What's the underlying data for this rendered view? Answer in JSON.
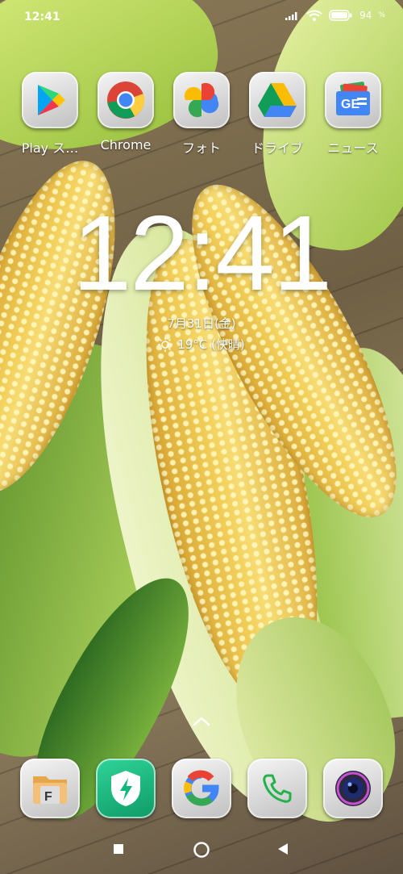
{
  "status_bar": {
    "time": "12:41",
    "battery_percent": "94",
    "icons": [
      "signal-icon",
      "wifi-icon",
      "battery-icon"
    ]
  },
  "apps": [
    {
      "label": "Play ス…",
      "icon": "play-store-icon"
    },
    {
      "label": "Chrome",
      "icon": "chrome-icon"
    },
    {
      "label": "フォト",
      "icon": "google-photos-icon"
    },
    {
      "label": "ドライブ",
      "icon": "google-drive-icon"
    },
    {
      "label": "ニュース",
      "icon": "google-news-icon"
    }
  ],
  "clock": {
    "time": "12:41",
    "date": "7月31日(金)",
    "weather": "19°C (快晴)",
    "weather_icon": "sun-icon"
  },
  "dock": [
    {
      "icon": "file-manager-icon"
    },
    {
      "icon": "security-icon"
    },
    {
      "icon": "google-icon"
    },
    {
      "icon": "phone-icon"
    },
    {
      "icon": "camera-icon"
    }
  ],
  "navigation": [
    "recents-button",
    "home-button",
    "back-button"
  ]
}
